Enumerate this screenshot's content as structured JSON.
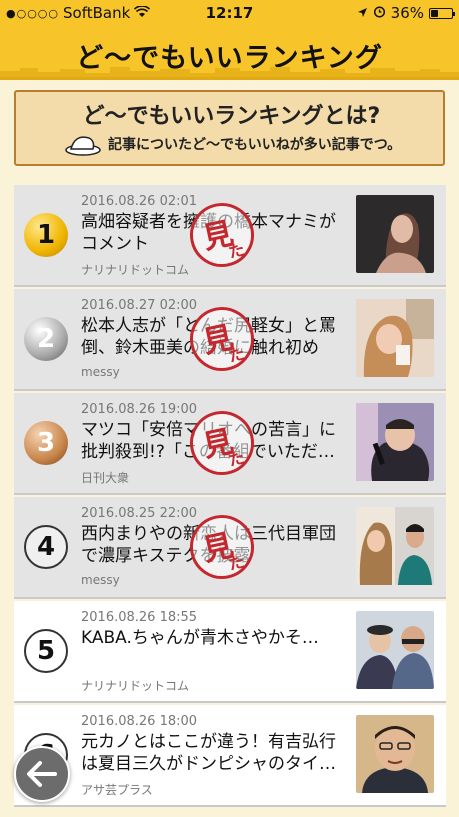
{
  "status_bar": {
    "carrier": "SoftBank",
    "time": "12:17",
    "battery": "36%",
    "battery_level": 0.36
  },
  "header": {
    "title": "ど〜でもいいランキング"
  },
  "banner": {
    "title": "ど〜でもいいランキングとは?",
    "subtitle": "記事についたど〜でもいいねが多い記事でつ。"
  },
  "stamp": {
    "char1": "見",
    "char2": "た"
  },
  "items": [
    {
      "rank": "1",
      "date": "2016.08.26 02:01",
      "title": "高畑容疑者を擁護の橋本マナミがコメント",
      "source": "ナリナリドットコム",
      "read": true
    },
    {
      "rank": "2",
      "date": "2016.08.27 02:00",
      "title": "松本人志が「とんだ尻軽女」と罵倒、鈴木亜美の結婚に触れ初めが…",
      "source": "messy",
      "read": true
    },
    {
      "rank": "3",
      "date": "2016.08.26 19:00",
      "title": "マツコ「安倍マリオへの苦言」に批判殺到!?「この番組でいただ…",
      "source": "日刊大衆",
      "read": true
    },
    {
      "rank": "4",
      "date": "2016.08.25 22:00",
      "title": "西内まりやの新恋人は三代目軍団で濃厚キステクを披露",
      "source": "messy",
      "read": true
    },
    {
      "rank": "5",
      "date": "2016.08.26 18:55",
      "title": "KABA.ちゃんが青木さやかそ…",
      "source": "ナリナリドットコム",
      "read": false
    },
    {
      "rank": "6",
      "date": "2016.08.26 18:00",
      "title": "元カノとはここが違う！有吉弘行は夏目三久がドンピシャのタイ…",
      "source": "アサ芸プラス",
      "read": false
    }
  ]
}
